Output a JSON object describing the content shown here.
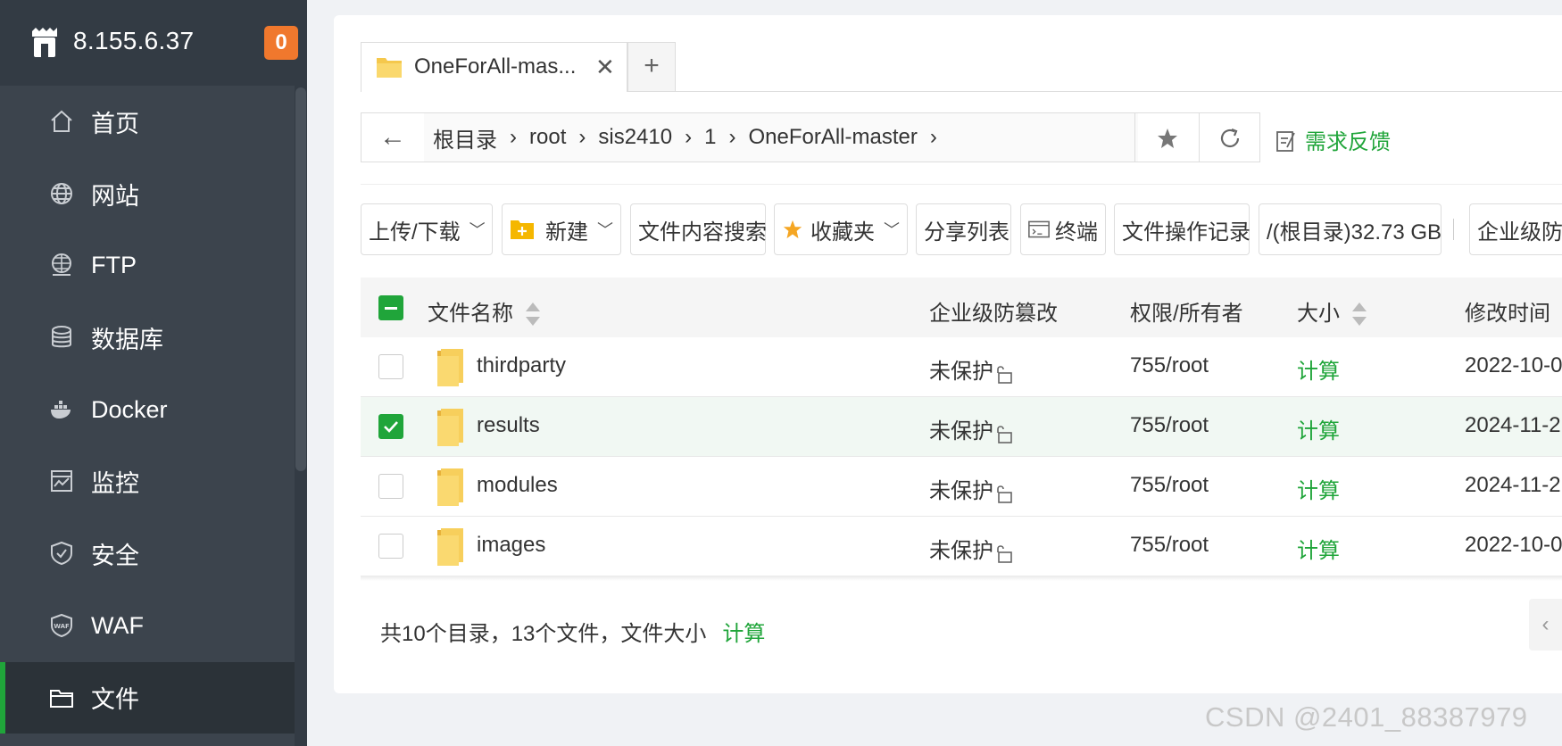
{
  "server": {
    "ip": "8.155.6.37",
    "alert_count": "0"
  },
  "sidebar": {
    "items": [
      {
        "label": "首页",
        "icon": "home-icon"
      },
      {
        "label": "网站",
        "icon": "globe-icon"
      },
      {
        "label": "FTP",
        "icon": "ftp-icon"
      },
      {
        "label": "数据库",
        "icon": "database-icon"
      },
      {
        "label": "Docker",
        "icon": "docker-icon"
      },
      {
        "label": "监控",
        "icon": "monitor-icon"
      },
      {
        "label": "安全",
        "icon": "shield-icon"
      },
      {
        "label": "WAF",
        "icon": "waf-icon"
      },
      {
        "label": "文件",
        "icon": "folder-icon",
        "active": true
      }
    ]
  },
  "tabs": [
    {
      "label": "OneForAll-mas...",
      "close": "✕"
    }
  ],
  "tab_add": "+",
  "breadcrumb": {
    "back": "←",
    "items": [
      "根目录",
      "root",
      "sis2410",
      "1",
      "OneForAll-master"
    ],
    "separator": "›"
  },
  "feedback": "需求反馈",
  "toolbar": {
    "upload": "上传/下载",
    "new": "新建",
    "search": "文件内容搜索",
    "favorites": "收藏夹",
    "share": "分享列表",
    "terminal": "终端",
    "history": "文件操作记录",
    "disk": "/(根目录)32.73 GB",
    "tamper": "企业级防篡"
  },
  "table": {
    "headers": {
      "name": "文件名称",
      "tamper": "企业级防篡改",
      "perm": "权限/所有者",
      "size": "大小",
      "mtime": "修改时间"
    },
    "rows": [
      {
        "name": "thirdparty",
        "tamper": "未保护",
        "perm": "755/root",
        "size": "计算",
        "mtime": "2022-10-0",
        "selected": false
      },
      {
        "name": "results",
        "tamper": "未保护",
        "perm": "755/root",
        "size": "计算",
        "mtime": "2024-11-2",
        "selected": true
      },
      {
        "name": "modules",
        "tamper": "未保护",
        "perm": "755/root",
        "size": "计算",
        "mtime": "2024-11-2",
        "selected": false
      },
      {
        "name": "images",
        "tamper": "未保护",
        "perm": "755/root",
        "size": "计算",
        "mtime": "2022-10-0",
        "selected": false
      }
    ]
  },
  "summary": {
    "text": "共10个目录，13个文件，文件大小",
    "calc": "计算"
  },
  "pager_prev": "‹",
  "watermark": "CSDN @2401_88387979",
  "colors": {
    "accent": "#20a53a",
    "sidebar": "#3c444d",
    "badge": "#f0782d",
    "folder": "#f5c84c"
  }
}
